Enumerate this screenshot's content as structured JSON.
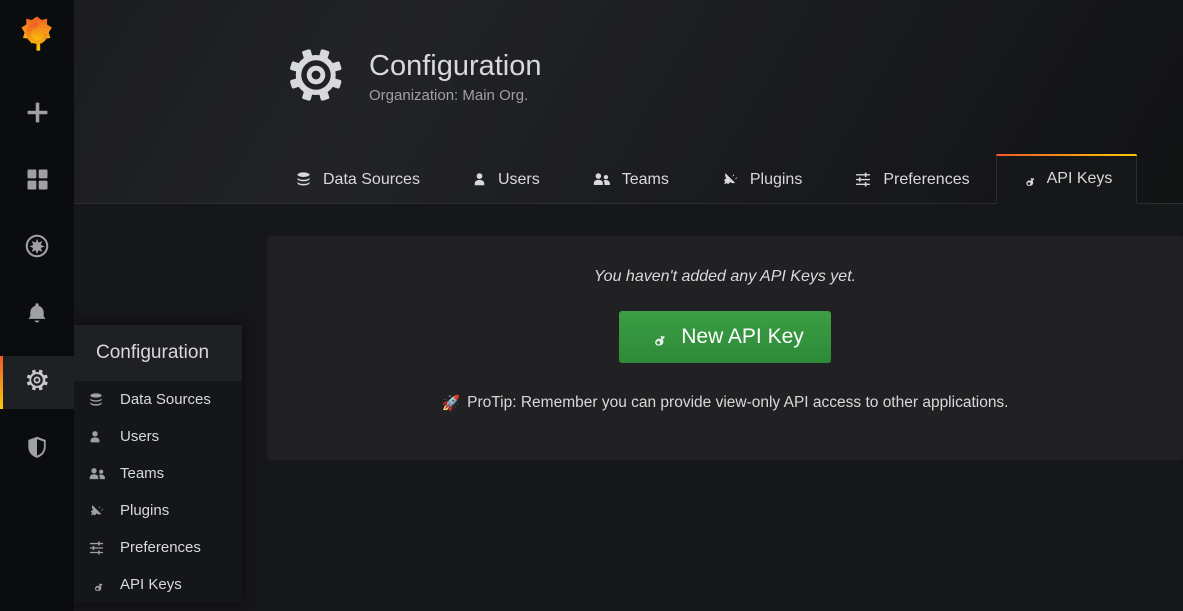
{
  "colors": {
    "accent_start": "#f05a28",
    "accent_end": "#fbca0a",
    "primary_button": "#3c9e45",
    "page_bg": "#161719",
    "panel_bg": "#212124",
    "sidenav_bg": "#0b0c0e",
    "text": "#d8d9da",
    "muted_text": "#9fa0a2"
  },
  "sidenav": {
    "brand": {
      "icon": "grafana-logo",
      "label": "Grafana"
    },
    "items": [
      {
        "icon": "plus-icon",
        "label": "Create",
        "active": false
      },
      {
        "icon": "dashboards-icon",
        "label": "Dashboards",
        "active": false
      },
      {
        "icon": "compass-icon",
        "label": "Explore",
        "active": false
      },
      {
        "icon": "bell-icon",
        "label": "Alerting",
        "active": false
      },
      {
        "icon": "gear-icon",
        "label": "Configuration",
        "active": true
      },
      {
        "icon": "shield-icon",
        "label": "Server Admin",
        "active": false
      }
    ]
  },
  "flyout": {
    "header": "Configuration",
    "items": [
      {
        "icon": "database-icon",
        "label": "Data Sources"
      },
      {
        "icon": "user-icon",
        "label": "Users"
      },
      {
        "icon": "users-icon",
        "label": "Teams"
      },
      {
        "icon": "plug-icon",
        "label": "Plugins"
      },
      {
        "icon": "sliders-icon",
        "label": "Preferences"
      },
      {
        "icon": "key-icon",
        "label": "API Keys"
      }
    ]
  },
  "header": {
    "icon": "gear-icon",
    "title": "Configuration",
    "subtitle": "Organization: Main Org."
  },
  "tabs": [
    {
      "icon": "database-icon",
      "label": "Data Sources",
      "active": false
    },
    {
      "icon": "user-icon",
      "label": "Users",
      "active": false
    },
    {
      "icon": "users-icon",
      "label": "Teams",
      "active": false
    },
    {
      "icon": "plug-icon",
      "label": "Plugins",
      "active": false
    },
    {
      "icon": "sliders-icon",
      "label": "Preferences",
      "active": false
    },
    {
      "icon": "key-icon",
      "label": "API Keys",
      "active": true
    }
  ],
  "panel": {
    "empty_message": "You haven't added any API Keys yet.",
    "new_key_button": {
      "icon": "key-icon",
      "label": "New API Key"
    },
    "protip": {
      "icon": "rocket-icon",
      "glyph": "🚀",
      "text": "ProTip: Remember you can provide view-only API access to other applications."
    }
  }
}
